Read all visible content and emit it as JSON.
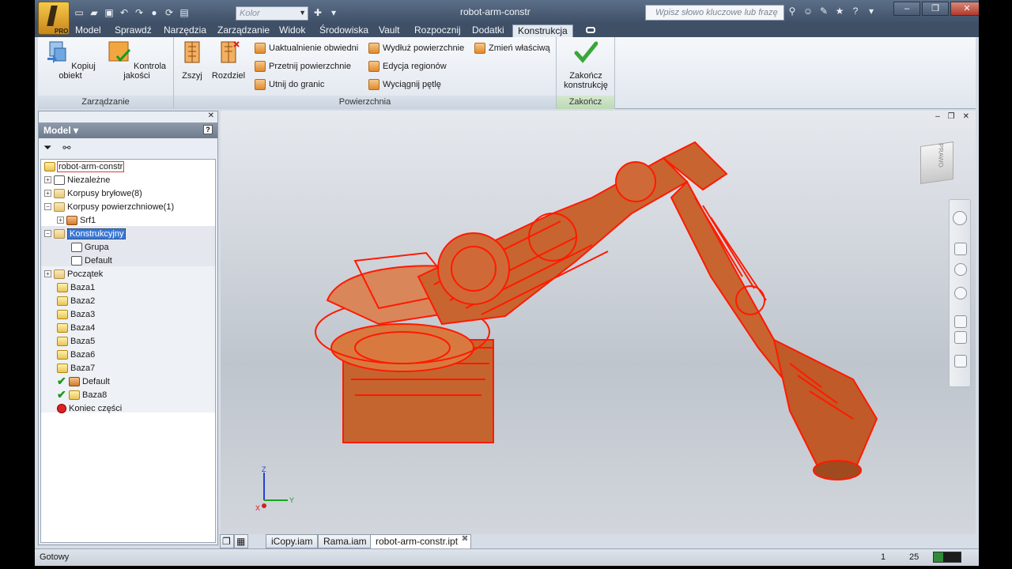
{
  "window": {
    "title": "robot-arm-constr",
    "app_badge": "PRO"
  },
  "quick_access": {
    "color_select": "Kolor"
  },
  "search": {
    "placeholder": "Wpisz słowo kluczowe lub frazę"
  },
  "menu_tabs": [
    "Model",
    "Sprawdź",
    "Narzędzia",
    "Zarządzanie",
    "Widok",
    "Środowiska",
    "Vault",
    "Rozpocznij",
    "Dodatki",
    "Konstrukcja"
  ],
  "active_tab": "Konstrukcja",
  "ribbon": {
    "zarzadzanie": {
      "label": "Zarządzanie",
      "copy_object": "Kopiuj obiekt",
      "quality_check": "Kontrola jakości"
    },
    "powierzchnia": {
      "label": "Powierzchnia",
      "stitch": "Zszyj",
      "split": "Rozdziel",
      "update_bounds": "Uaktualnienie obwiedni",
      "intersect_surfaces": "Przetnij powierzchnie",
      "trim_to_edge": "Utnij do granic",
      "extend_surface": "Wydłuż powierzchnie",
      "edit_regions": "Edycja regionów",
      "extract_loop": "Wyciągnij pętlę",
      "change_property": "Zmień właściwą"
    },
    "zakoncz": {
      "label": "Zakończ",
      "finish_line1": "Zakończ",
      "finish_line2": "konstrukcję"
    }
  },
  "browser": {
    "title": "Model",
    "help": "?",
    "tree": [
      {
        "label": "robot-arm-constr"
      },
      {
        "label": "Niezależne"
      },
      {
        "label": "Korpusy bryłowe(8)"
      },
      {
        "label": "Korpusy powierzchniowe(1)"
      },
      {
        "label": "Srf1"
      },
      {
        "label": "Konstrukcyjny"
      },
      {
        "label": "Grupa"
      },
      {
        "label": "Default"
      },
      {
        "label": "Początek"
      },
      {
        "label": "Baza1"
      },
      {
        "label": "Baza2"
      },
      {
        "label": "Baza3"
      },
      {
        "label": "Baza4"
      },
      {
        "label": "Baza5"
      },
      {
        "label": "Baza6"
      },
      {
        "label": "Baza7"
      },
      {
        "label": "Default"
      },
      {
        "label": "Baza8"
      },
      {
        "label": "Koniec części"
      }
    ]
  },
  "viewcube": {
    "label": "PRAWO"
  },
  "triad": {
    "x": "X",
    "y": "Y",
    "z": "Z"
  },
  "doc_tabs": [
    "iCopy.iam",
    "Rama.iam",
    "robot-arm-constr.ipt"
  ],
  "status": {
    "text": "Gotowy",
    "num1": "1",
    "num2": "25",
    "progress": 0.35
  },
  "colors": {
    "accent": "#3e4f66",
    "model_red": "#ff1a00",
    "model_fill": "#c85a2a"
  }
}
